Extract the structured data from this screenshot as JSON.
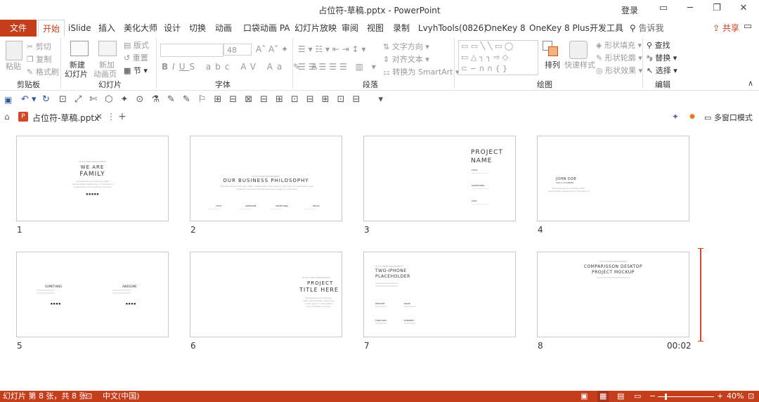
{
  "window": {
    "title": "占位符-草稿.pptx  -  PowerPoint",
    "login": "登录"
  },
  "tabs": {
    "file": "文件",
    "items": [
      "开始",
      "iSlide",
      "插入",
      "美化大师",
      "设计",
      "切换",
      "动画",
      "口袋动画 PA",
      "幻灯片放映",
      "审阅",
      "视图",
      "录制",
      "LvyhTools(0826)",
      "OneKey 8",
      "OneKey 8 Plus",
      "开发工具",
      "告诉我"
    ],
    "share": "共享"
  },
  "ribbon": {
    "clipboard": {
      "paste": "粘贴",
      "cut": "剪切",
      "copy": "复制",
      "format_painter": "格式刷",
      "label": "剪贴板"
    },
    "slides": {
      "new_slide_1": "新建",
      "new_slide_2": "幻灯片",
      "reuse_1": "新加",
      "reuse_2": "动画页",
      "layout": "版式",
      "reset": "重置",
      "section": "节",
      "label": "幻灯片"
    },
    "font": {
      "size": "48",
      "label": "字体"
    },
    "paragraph": {
      "text_direction": "文字方向",
      "align_text": "对齐文本",
      "smartart": "转换为 SmartArt",
      "label": "段落"
    },
    "drawing": {
      "arrange": "排列",
      "quick_styles": "快速样式",
      "shape_fill": "形状填充",
      "shape_outline": "形状轮廓",
      "shape_effects": "形状效果",
      "label": "绘图"
    },
    "editing": {
      "find": "查找",
      "replace": "替换",
      "select": "选择",
      "label": "编辑"
    }
  },
  "doc_tab": {
    "name": "占位符-草稿.pptx",
    "multiwindow": "多窗口模式"
  },
  "slides": [
    {
      "num": "1",
      "top_tag": "STYLE HERE DEPARTMENT",
      "title1": "WE ARE",
      "title2": "FAMILY",
      "body": "Entrepreneurial activities differ substantially depending on the type of organization and creativity involved.",
      "footer": "■ ■ ■ ■ ■"
    },
    {
      "num": "2",
      "top_tag": "STYLE HERE DEPARTMENT",
      "title": "OUR BUSINESS PHILOSOPHY",
      "body": "Entrepreneurial activities differ substantially depending on the type of organization and creativity involved. Entrepreneurship ranges in scale from",
      "cols": [
        "TITLE",
        "AWESOME",
        "SOMETHING",
        "HELLO"
      ]
    },
    {
      "num": "3",
      "title1": "PROJECT",
      "title2": "NAME",
      "items": [
        "TITLE",
        "SOMETHING",
        "TEXT"
      ]
    },
    {
      "num": "4",
      "title": "JOHN DOE",
      "subtitle": "CEO & FOUNDER",
      "body": "Entrepreneurial activities differ substantially depending on the type of"
    },
    {
      "num": "5",
      "cols": [
        "SOMETHING",
        "AWESOME"
      ]
    },
    {
      "num": "6",
      "top_tag": "STYLE HERE DEPARTMENT",
      "title1": "PROJECT",
      "title2": "TITLE HERE",
      "body": "Entrepreneurial activities differ substantially depending on the type of organization and creativity involved."
    },
    {
      "num": "7",
      "top_tag": "STYLE HERE DEPARTMENT",
      "title1": "TWO-IPHONE",
      "title2": "PLACEHOLDER",
      "items": [
        "FEATURE",
        "NAME",
        "FUNCTION",
        "ELEMENT"
      ]
    },
    {
      "num": "8",
      "top_tag": "STYLE HERE DEPARTMENT",
      "title1": "COMPARISSON DESKTOP",
      "title2": "PROJECT MOCKUP",
      "duration": "00:02"
    }
  ],
  "status": {
    "slide_info": "幻灯片 第 8 张，共 8 张",
    "language": "中文(中国)",
    "zoom": "40%"
  },
  "colors": {
    "accent": "#c43e1c",
    "selection": "#d24726"
  }
}
